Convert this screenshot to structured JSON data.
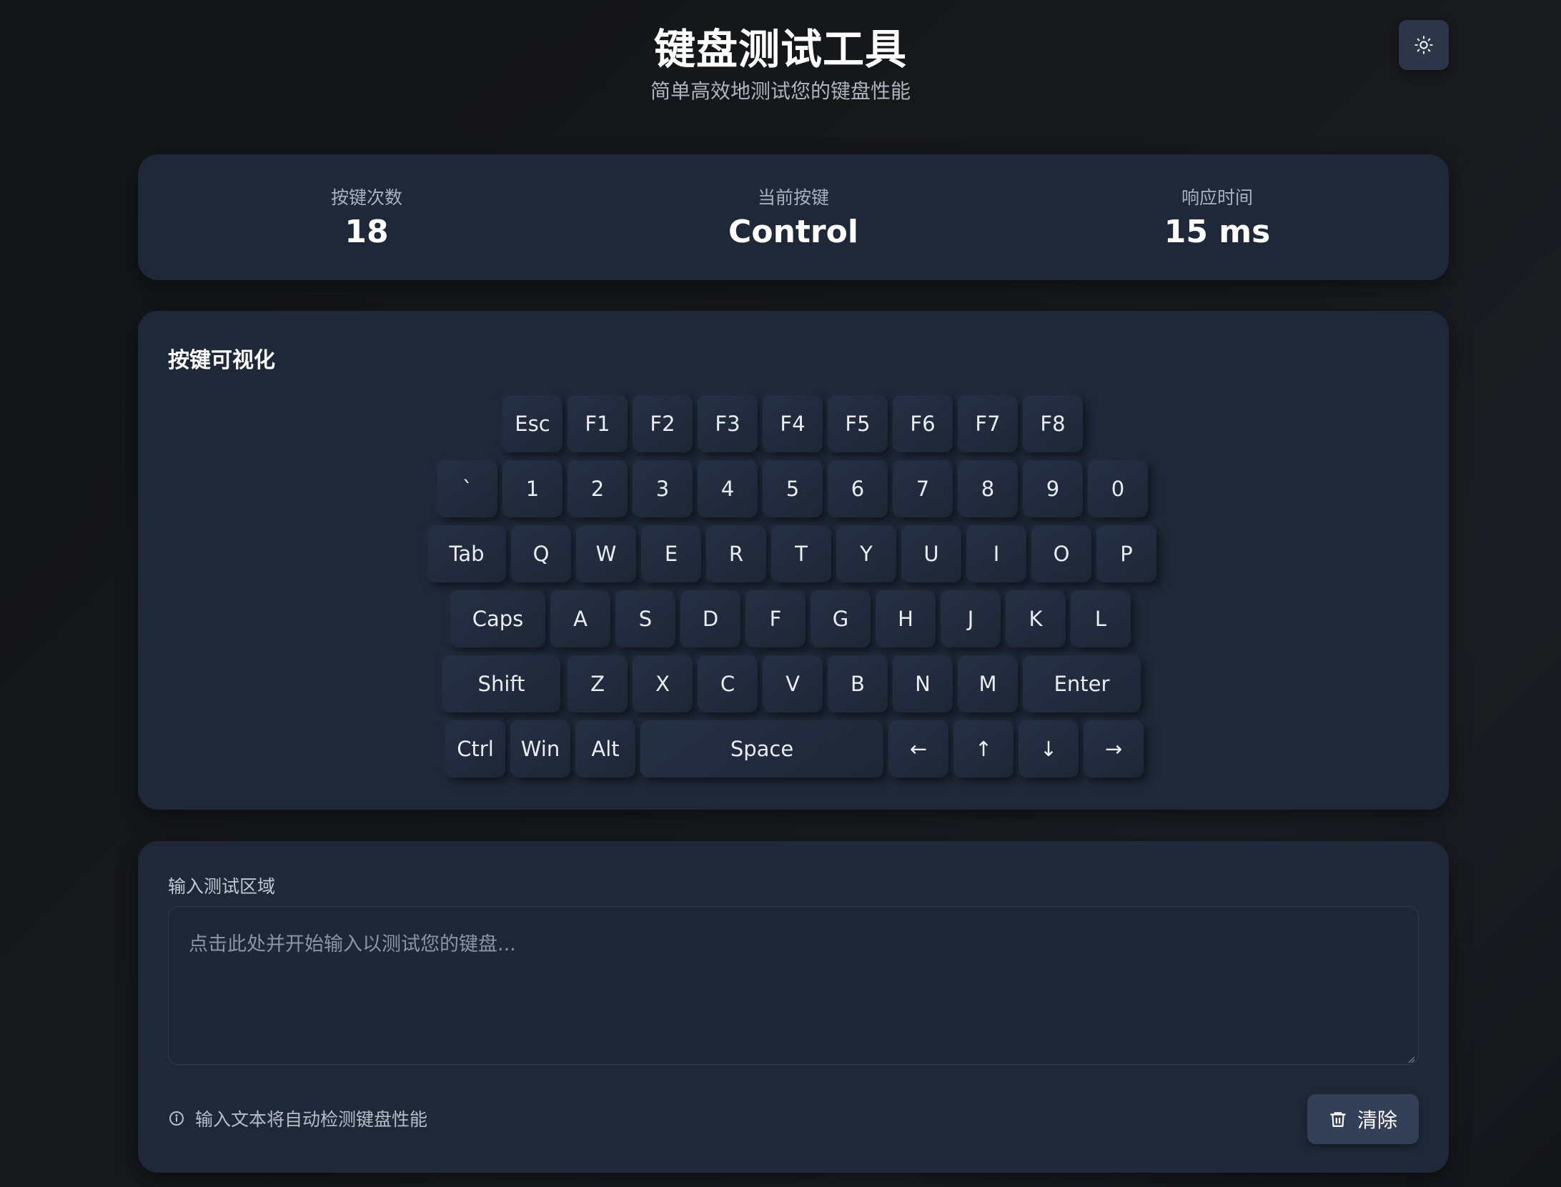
{
  "header": {
    "title": "键盘测试工具",
    "subtitle": "简单高效地测试您的键盘性能",
    "theme_toggle_icon": "sun-icon"
  },
  "stats": {
    "press_count": {
      "label": "按键次数",
      "value": "18"
    },
    "current_key": {
      "label": "当前按键",
      "value": "Control"
    },
    "response_time": {
      "label": "响应时间",
      "value": "15 ms"
    }
  },
  "keyboard": {
    "title": "按键可视化",
    "rows": [
      [
        "Esc",
        "F1",
        "F2",
        "F3",
        "F4",
        "F5",
        "F6",
        "F7",
        "F8"
      ],
      [
        "`",
        "1",
        "2",
        "3",
        "4",
        "5",
        "6",
        "7",
        "8",
        "9",
        "0"
      ],
      [
        "Tab",
        "Q",
        "W",
        "E",
        "R",
        "T",
        "Y",
        "U",
        "I",
        "O",
        "P"
      ],
      [
        "Caps",
        "A",
        "S",
        "D",
        "F",
        "G",
        "H",
        "J",
        "K",
        "L"
      ],
      [
        "Shift",
        "Z",
        "X",
        "C",
        "V",
        "B",
        "N",
        "M",
        "Enter"
      ],
      [
        "Ctrl",
        "Win",
        "Alt",
        "Space",
        "←",
        "↑",
        "↓",
        "→"
      ]
    ]
  },
  "input_area": {
    "label": "输入测试区域",
    "placeholder": "点击此处并开始输入以测试您的键盘...",
    "hint": "输入文本将自动检测键盘性能",
    "hint_icon": "info-icon",
    "clear_label": "清除",
    "clear_icon": "trash-icon"
  },
  "colors": {
    "background": "#151619",
    "card": "#1f2839",
    "key": "#232c3f",
    "button": "#334058"
  }
}
